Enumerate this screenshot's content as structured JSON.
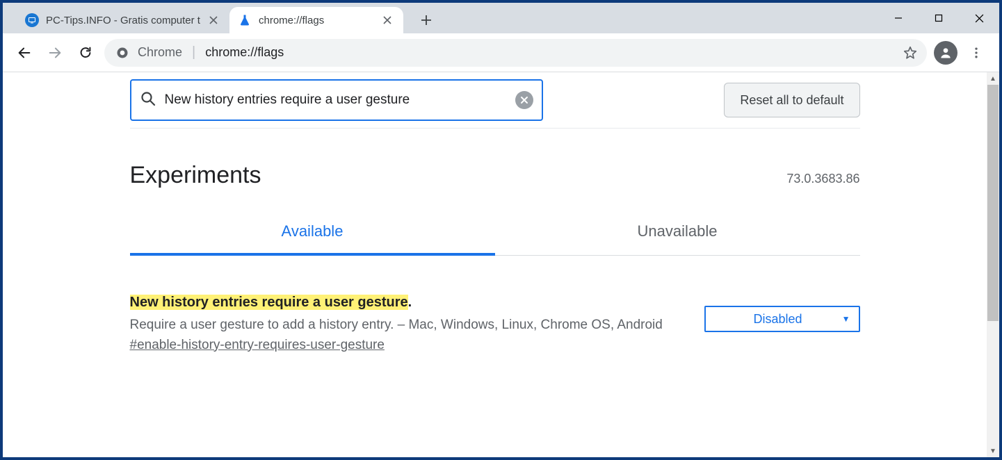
{
  "tabs": [
    {
      "title": "PC-Tips.INFO - Gratis computer t"
    },
    {
      "title": "chrome://flags"
    }
  ],
  "addressbar": {
    "origin": "Chrome",
    "path": "chrome://flags"
  },
  "search": {
    "value": "New history entries require a user gesture"
  },
  "reset_button": "Reset all to default",
  "heading": "Experiments",
  "version": "73.0.3683.86",
  "flag_tabs": {
    "available": "Available",
    "unavailable": "Unavailable"
  },
  "flag": {
    "title_highlight": "New history entries require a user gesture",
    "title_suffix": ".",
    "description": "Require a user gesture to add a history entry. – Mac, Windows, Linux, Chrome OS, Android",
    "hash": "#enable-history-entry-requires-user-gesture",
    "select_value": "Disabled"
  }
}
